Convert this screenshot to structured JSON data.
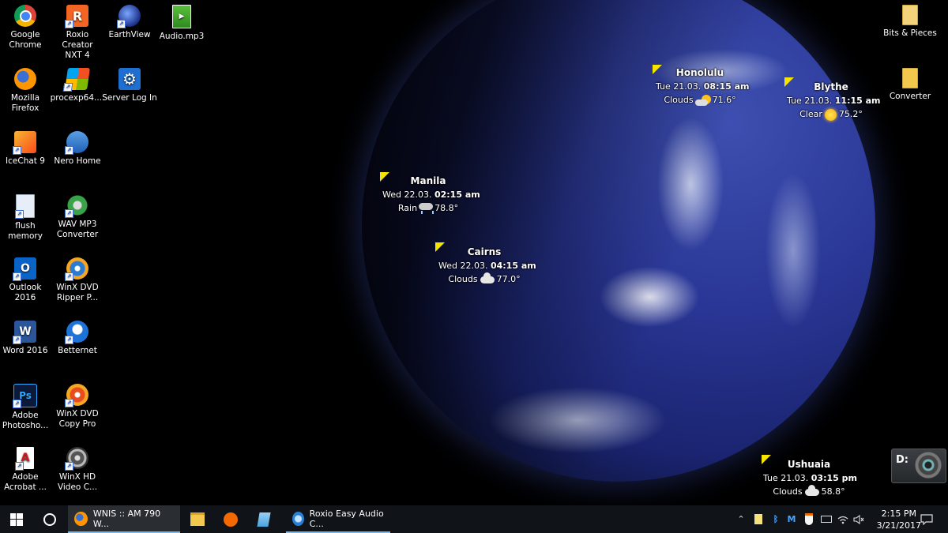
{
  "desktop_icons": {
    "google_chrome": "Google\nChrome",
    "roxio_creator": "Roxio Creator\nNXT 4",
    "earthview": "EarthView",
    "audio_mp3": "Audio.mp3",
    "bits_and_pieces": "Bits & Pieces",
    "mozilla_firefox": "Mozilla\nFirefox",
    "procexp": "procexp64....",
    "server_log_in": "Server Log In",
    "converter": "Converter",
    "icechat": "IceChat 9",
    "nero_home": "Nero Home",
    "flush_memory": "flush\nmemory",
    "wav_mp3": "WAV MP3\nConverter",
    "outlook": "Outlook 2016",
    "winx_dvd_ripper": "WinX DVD\nRipper P...",
    "word": "Word 2016",
    "betternet": "Betternet",
    "photoshop": "Adobe\nPhotosho...",
    "winx_dvd_copy": "WinX DVD\nCopy Pro",
    "acrobat": "Adobe\nAcrobat ...",
    "winx_hd": "WinX HD\nVideo C..."
  },
  "cities": {
    "honolulu": {
      "name": "Honolulu",
      "date": "Tue 21.03.",
      "time": "08:15 am",
      "cond": "Clouds",
      "temp": "71.6°"
    },
    "blythe": {
      "name": "Blythe",
      "date": "Tue 21.03.",
      "time": "11:15 am",
      "cond": "Clear",
      "temp": "75.2°"
    },
    "manila": {
      "name": "Manila",
      "date": "Wed 22.03.",
      "time": "02:15 am",
      "cond": "Rain",
      "temp": "78.8°"
    },
    "cairns": {
      "name": "Cairns",
      "date": "Wed 22.03.",
      "time": "04:15 am",
      "cond": "Clouds",
      "temp": "77.0°"
    },
    "ushuaia": {
      "name": "Ushuaia",
      "date": "Tue 21.03.",
      "time": "03:15 pm",
      "cond": "Clouds",
      "temp": "58.8°"
    }
  },
  "drive_widget": {
    "letter": "D:"
  },
  "taskbar": {
    "app_firefox": "WNIS :: AM 790 W...",
    "app_roxio": "Roxio Easy Audio C...",
    "clock_time": "2:15 PM",
    "clock_date": "3/21/2017"
  },
  "colors": {
    "flag": "#f4e400",
    "taskbar": "#101317",
    "accent": "#76b9ed"
  }
}
